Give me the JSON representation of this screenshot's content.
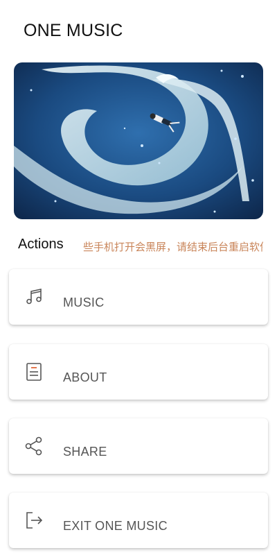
{
  "app": {
    "title": "ONE MUSIC"
  },
  "banner": {
    "image": "phoenix-illustration"
  },
  "actions": {
    "label": "Actions",
    "marquee_text": "些手机打开会黑屏，请结束后台重启软件"
  },
  "menu": [
    {
      "label": "MUSIC",
      "icon": "music-note-icon"
    },
    {
      "label": "ABOUT",
      "icon": "document-icon"
    },
    {
      "label": "SHARE",
      "icon": "share-icon"
    },
    {
      "label": "EXIT ONE MUSIC",
      "icon": "exit-icon"
    }
  ],
  "colors": {
    "marquee": "#c9855a",
    "accent": "#e0673a"
  }
}
